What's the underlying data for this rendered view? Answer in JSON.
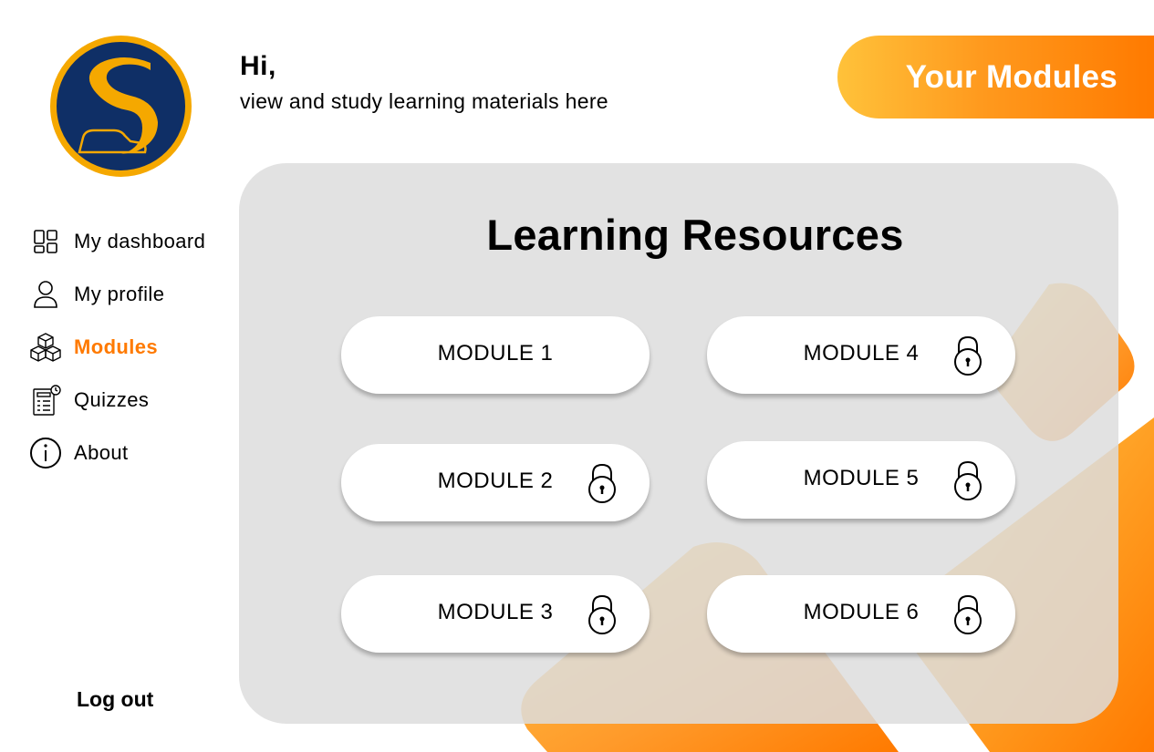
{
  "greeting": {
    "title": "Hi,",
    "subtitle": "view and study learning materials here"
  },
  "header": {
    "pill_label": "Your Modules"
  },
  "sidebar": {
    "items": [
      {
        "label": "My dashboard",
        "icon": "dashboard-icon"
      },
      {
        "label": "My profile",
        "icon": "user-icon"
      },
      {
        "label": "Modules",
        "icon": "cubes-icon",
        "active": true
      },
      {
        "label": "Quizzes",
        "icon": "quiz-icon"
      },
      {
        "label": "About",
        "icon": "info-icon"
      }
    ],
    "logout_label": "Log out"
  },
  "main": {
    "title": "Learning Resources",
    "modules": [
      {
        "label": "MODULE 1",
        "locked": false
      },
      {
        "label": "MODULE 2",
        "locked": true
      },
      {
        "label": "MODULE 3",
        "locked": true
      },
      {
        "label": "MODULE 4",
        "locked": true
      },
      {
        "label": "MODULE 5",
        "locked": true
      },
      {
        "label": "MODULE 6",
        "locked": true
      }
    ]
  },
  "colors": {
    "accent": "#ff7a00",
    "accent_light": "#ffc23a",
    "logo_navy": "#0f2f66",
    "logo_gold": "#f5a800",
    "panel": "#dddddd"
  }
}
